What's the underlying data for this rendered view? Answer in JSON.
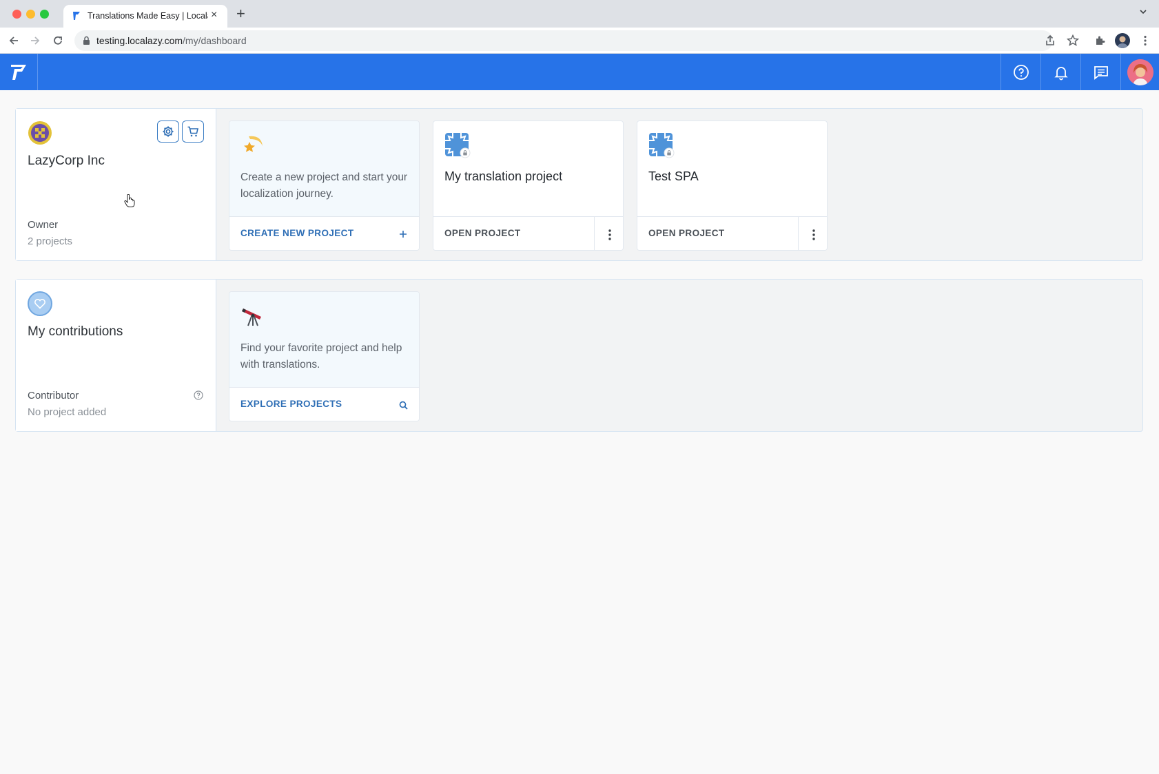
{
  "browser": {
    "tab_title": "Translations Made Easy | Localazy",
    "url_host": "testing.localazy.com",
    "url_path": "/my/dashboard"
  },
  "app": {
    "brand_color": "#2773e8"
  },
  "organization": {
    "name": "LazyCorp Inc",
    "role": "Owner",
    "project_count": "2 projects",
    "create_card": {
      "description": "Create a new project and start your localization journey.",
      "action_label": "CREATE NEW PROJECT"
    },
    "projects": [
      {
        "name": "My translation project",
        "action_label": "OPEN PROJECT"
      },
      {
        "name": "Test SPA",
        "action_label": "OPEN PROJECT"
      }
    ]
  },
  "contributions": {
    "title": "My contributions",
    "role": "Contributor",
    "status": "No project added",
    "explore_card": {
      "description": "Find your favorite project and help with translations.",
      "action_label": "EXPLORE PROJECTS"
    }
  }
}
